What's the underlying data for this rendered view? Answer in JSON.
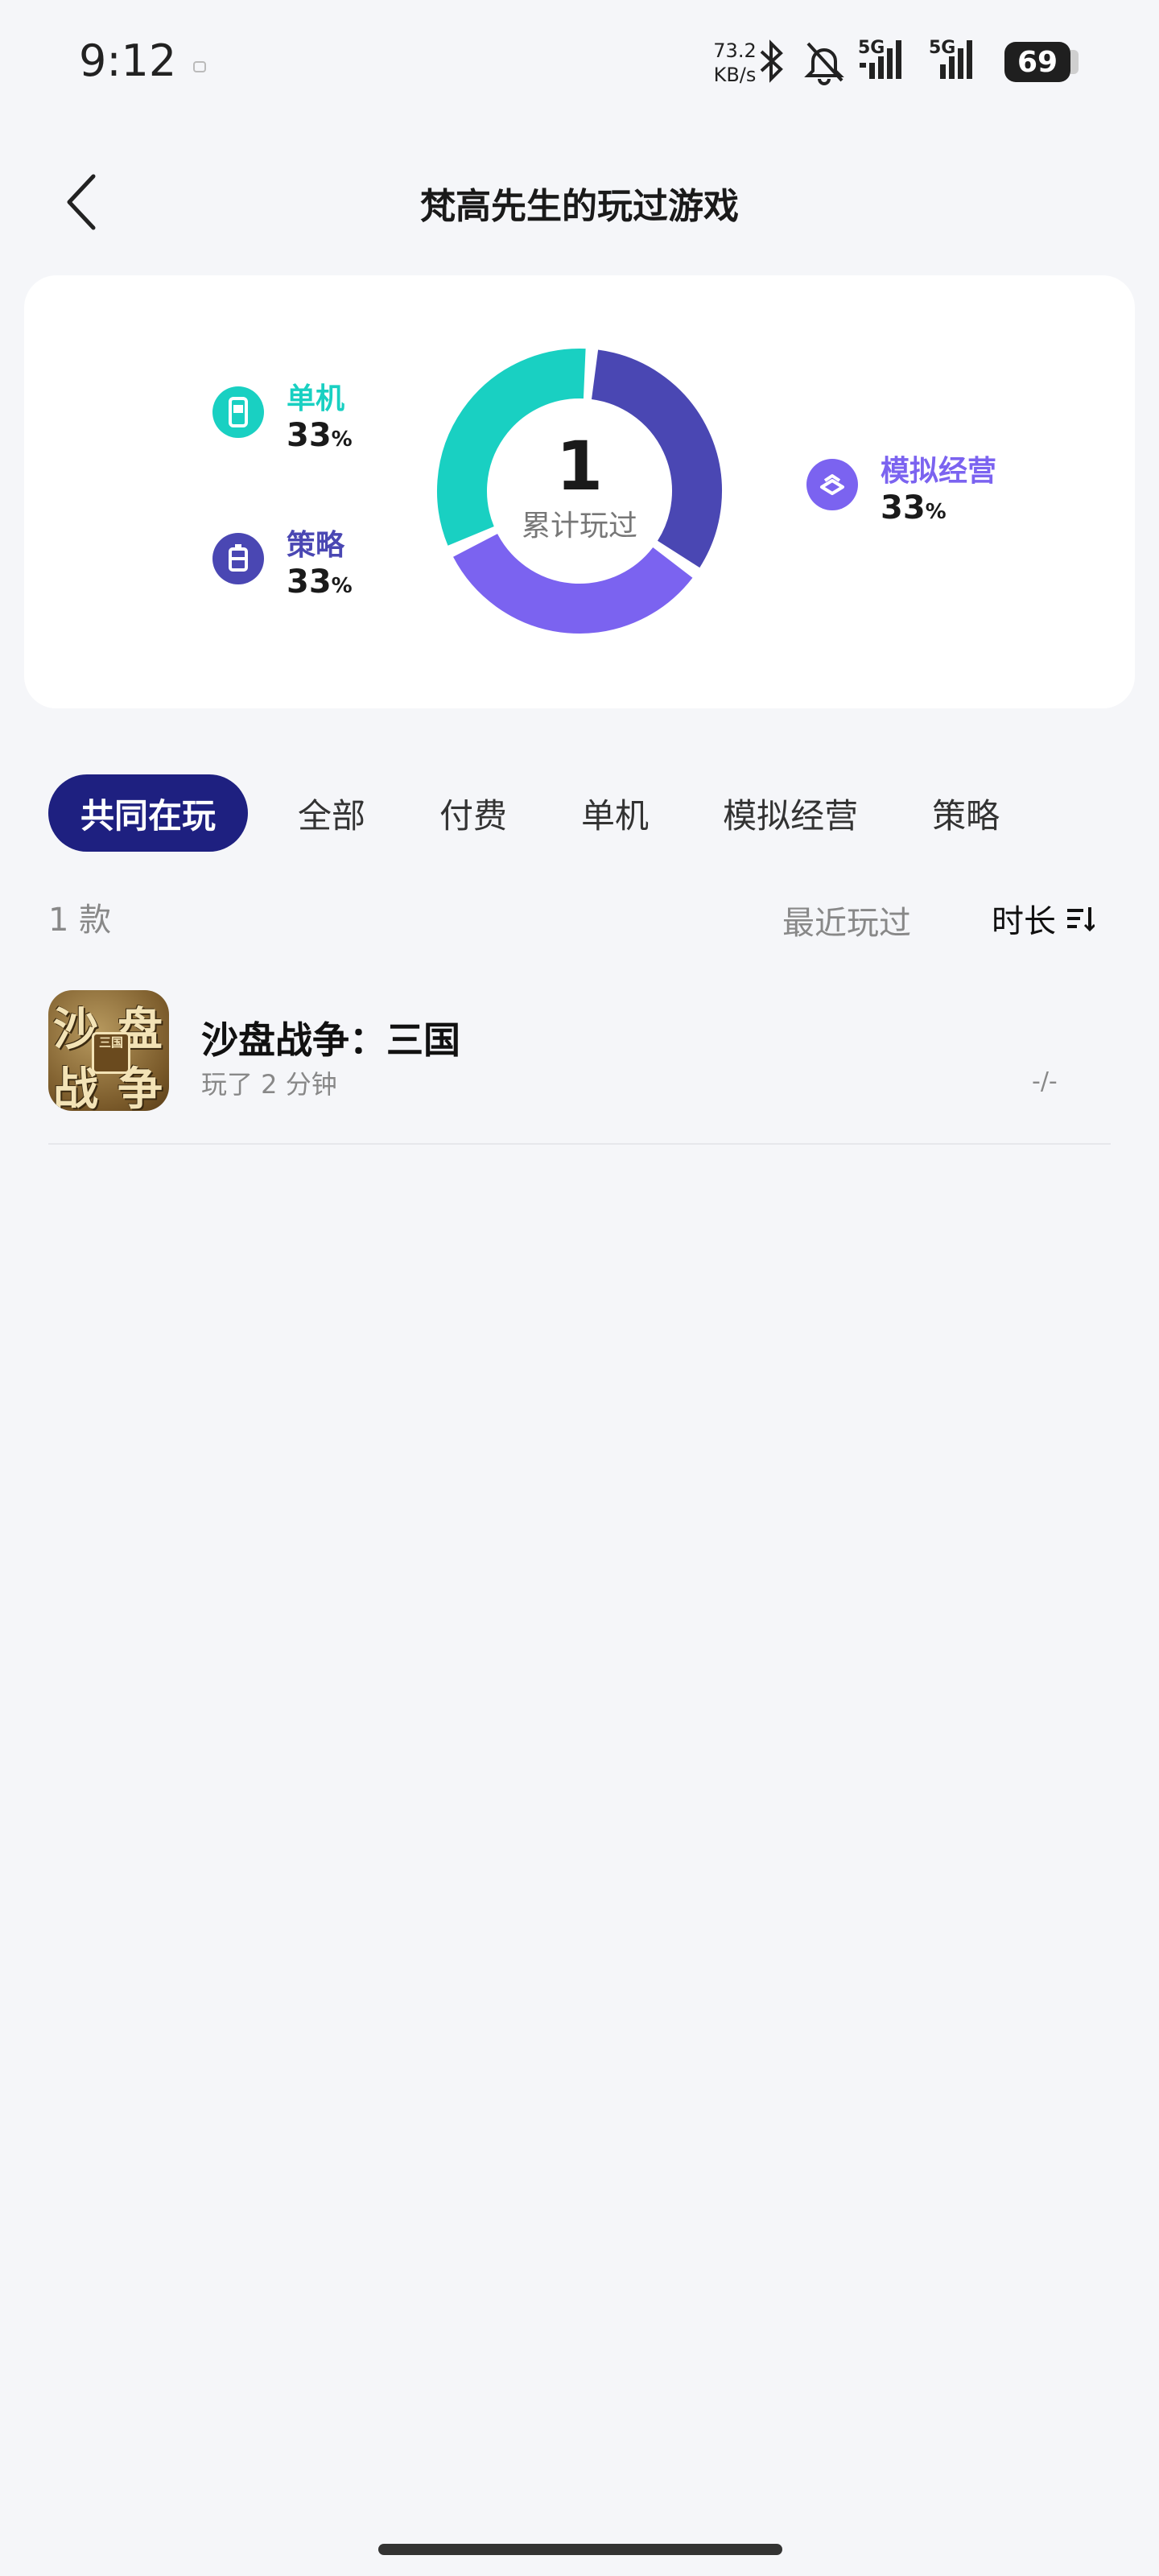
{
  "status_bar": {
    "time": "9:12",
    "net_speed_value": "73.2",
    "net_speed_unit": "KB/s",
    "network_1": "5G",
    "network_2": "5G",
    "battery": "69"
  },
  "header": {
    "title": "梵高先生的玩过游戏"
  },
  "stats": {
    "total_count": "1",
    "total_label": "累计玩过",
    "legend": [
      {
        "label": "单机",
        "percent": "33",
        "unit": "%",
        "color": "#19d0c2",
        "icon": "phone-game-icon"
      },
      {
        "label": "策略",
        "percent": "33",
        "unit": "%",
        "color": "#4a47b3",
        "icon": "strategy-icon"
      },
      {
        "label": "模拟经营",
        "percent": "33",
        "unit": "%",
        "color": "#7b63f0",
        "icon": "simulation-icon"
      }
    ],
    "segments": [
      {
        "label": "单机",
        "share": 0.3333,
        "color": "#19d0c2"
      },
      {
        "label": "策略",
        "share": 0.3333,
        "color": "#4a47b3"
      },
      {
        "label": "模拟经营",
        "share": 0.3333,
        "color": "#7b63f0"
      }
    ]
  },
  "tabs": [
    {
      "label": "共同在玩",
      "active": true
    },
    {
      "label": "全部",
      "active": false
    },
    {
      "label": "付费",
      "active": false
    },
    {
      "label": "单机",
      "active": false
    },
    {
      "label": "模拟经营",
      "active": false
    },
    {
      "label": "策略",
      "active": false
    }
  ],
  "list": {
    "count_label": "1 款",
    "sort_recent": "最近玩过",
    "sort_duration": "时长"
  },
  "games": [
    {
      "name": "沙盘战争：三国",
      "play_time": "玩了 2 分钟",
      "score": "-/-",
      "icon_text": [
        "沙",
        "盘",
        "战",
        "争"
      ],
      "icon_mid": "三国"
    }
  ]
}
